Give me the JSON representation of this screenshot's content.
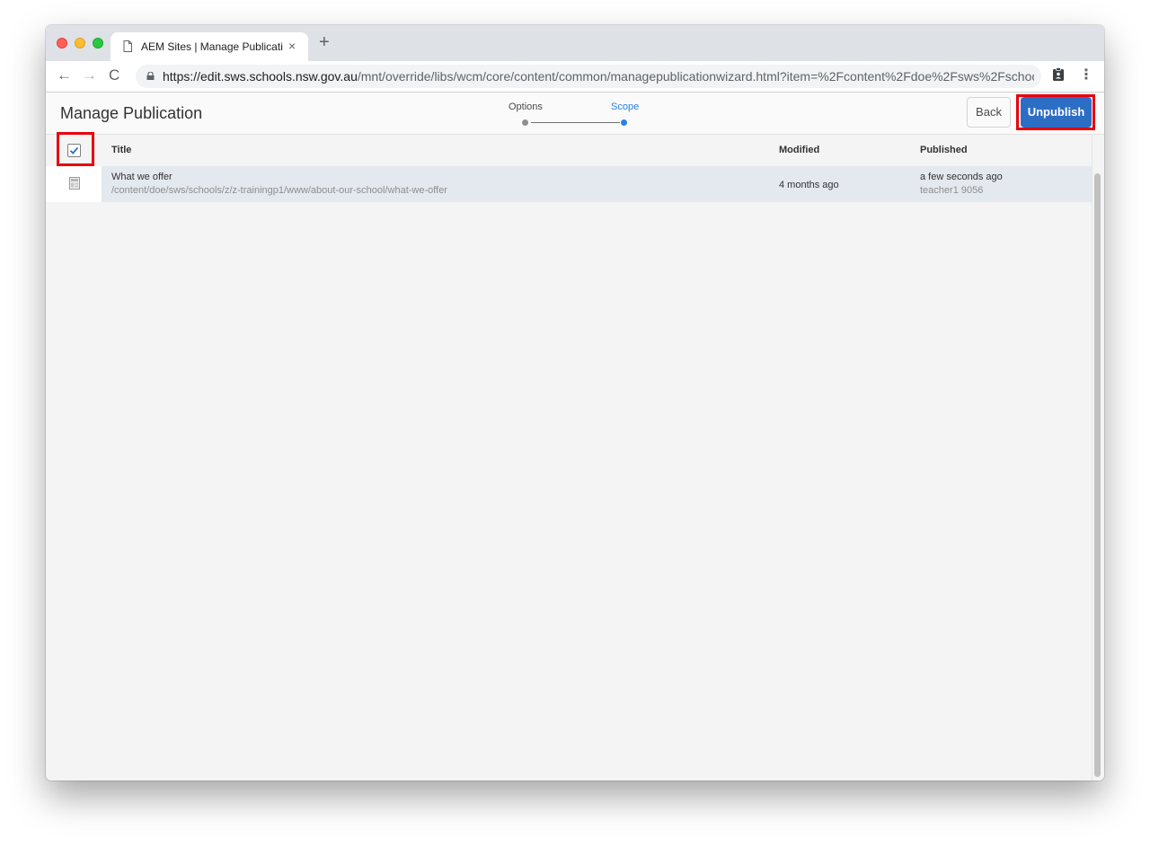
{
  "browser": {
    "tab_title": "AEM Sites | Manage Publication",
    "tab_close": "×",
    "new_tab": "+",
    "url_host": "https://edit.sws.schools.nsw.gov.au",
    "url_path": "/mnt/override/libs/wcm/core/content/common/managepublicationwizard.html?item=%2Fcontent%2Fdoe%2Fsws%2Fschools...",
    "back_glyph": "←",
    "forward_glyph": "→",
    "reload_glyph": "C",
    "menu_glyph": "⋮"
  },
  "header": {
    "title": "Manage Publication",
    "steps": [
      "Options",
      "Scope"
    ],
    "active_step": "Scope",
    "back_label": "Back",
    "unpublish_label": "Unpublish"
  },
  "table": {
    "select_all_checked": true,
    "columns": {
      "title": "Title",
      "modified": "Modified",
      "published": "Published"
    },
    "rows": [
      {
        "title": "What we offer",
        "path": "/content/doe/sws/schools/z/z-trainingp1/www/about-our-school/what-we-offer",
        "modified": "4 months ago",
        "published": "a few seconds ago",
        "published_by": "teacher1 9056"
      }
    ]
  },
  "colors": {
    "accent": "#2d6ec5",
    "highlight": "#e8000b",
    "step_active": "#2680eb"
  }
}
